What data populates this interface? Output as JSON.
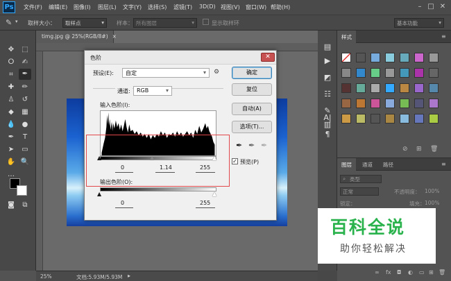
{
  "app": {
    "logo": "Ps"
  },
  "menu": [
    "文件(F)",
    "编辑(E)",
    "图像(I)",
    "图层(L)",
    "文字(Y)",
    "选择(S)",
    "滤镜(T)",
    "3D(D)",
    "视图(V)",
    "窗口(W)",
    "帮助(H)"
  ],
  "options": {
    "sample_size_label": "取样大小：",
    "sample_size_value": "取样点",
    "sample_label": "样本：",
    "sample_value": "所有图层",
    "show_ring_label": "显示取样环",
    "workspace": "基本功能"
  },
  "document": {
    "tab": "timg.jpg @ 25%(RGB/8#)",
    "zoom": "25%",
    "doc_size": "文档:5.93M/5.93M"
  },
  "dialog": {
    "title": "色阶",
    "preset_label": "预设(E):",
    "preset_value": "自定",
    "channel_label": "通道:",
    "channel_value": "RGB",
    "input_label": "输入色阶(I):",
    "output_label": "输出色阶(O):",
    "input_values": [
      "0",
      "1.14",
      "255"
    ],
    "output_values": [
      "0",
      "255"
    ],
    "buttons": {
      "ok": "确定",
      "reset": "复位",
      "auto": "自动(A)",
      "options": "选项(T)..."
    },
    "preview_label": "预览(P)",
    "preview_checked": true
  },
  "panels": {
    "styles_tab": "样式",
    "layer_tabs": [
      "图层",
      "通道",
      "路径"
    ],
    "kind_label": "类型",
    "blend_mode": "正常",
    "opacity_label": "不透明度：",
    "opacity_value": "100%",
    "lock_label": "锁定：",
    "fill_label": "填充：",
    "fill_value": "100%"
  },
  "watermark": {
    "title": "百科全说",
    "subtitle": "助你轻松解决"
  },
  "colors": {
    "accent": "#31a8ff",
    "highlight_box": "#e0484c",
    "watermark_green": "#2ab24d"
  }
}
